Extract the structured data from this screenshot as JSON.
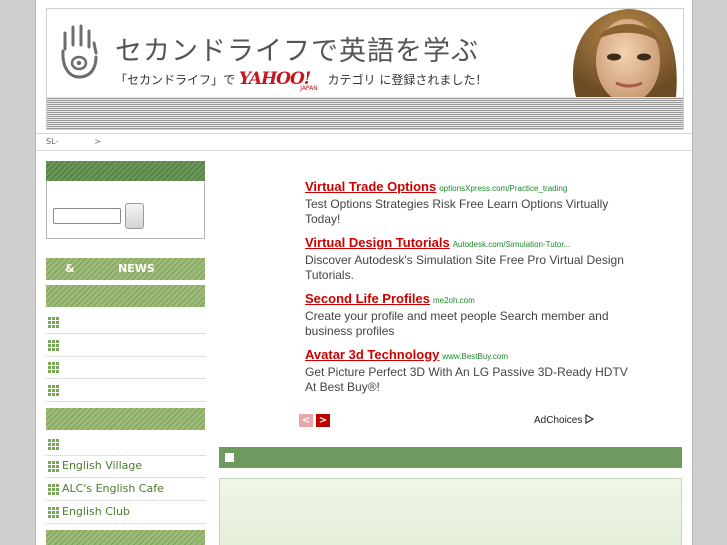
{
  "header": {
    "site_title": "セカンドライフで英語を学ぶ",
    "yahoo_prefix": "「セカンドライフ」で",
    "yahoo_logo": "YAHOO!",
    "yahoo_sub": "JAPAN",
    "yahoo_suffix": "カテゴリ に登録されました！"
  },
  "breadcrumb": {
    "home": "SL-",
    "separator": ">"
  },
  "sidebar": {
    "news_bar": {
      "left": "&",
      "right": "NEWS"
    },
    "items_top": [
      "",
      "",
      "",
      ""
    ],
    "items_bottom": [
      "",
      "English Village",
      "ALC's English Cafe",
      "English Club"
    ]
  },
  "ads": [
    {
      "title": "Virtual Trade Options",
      "url": "optionsXpress.com/Practice_trading",
      "desc": "Test Options Strategies Risk Free Learn Options Virtually Today!"
    },
    {
      "title": "Virtual Design Tutorials",
      "url": "Autodesk.com/Simulation-Tutor...",
      "desc": "Discover Autodesk's Simulation Site Free Pro Virtual Design Tutorials."
    },
    {
      "title": "Second Life Profiles",
      "url": "me2oh.com",
      "desc": "Create your profile and meet people Search member and business profiles"
    },
    {
      "title": "Avatar 3d Technology",
      "url": "www.BestBuy.com",
      "desc": "Get Picture Perfect 3D With An LG Passive 3D-Ready HDTV At Best Buy®!"
    }
  ],
  "ad_nav": {
    "prev": "<",
    "next": ">"
  },
  "adchoices": {
    "label": "AdChoices"
  },
  "colors": {
    "accent_green": "#6e9a60",
    "ad_title_red": "#cc0000",
    "ad_url_green": "#1a8a2a"
  }
}
